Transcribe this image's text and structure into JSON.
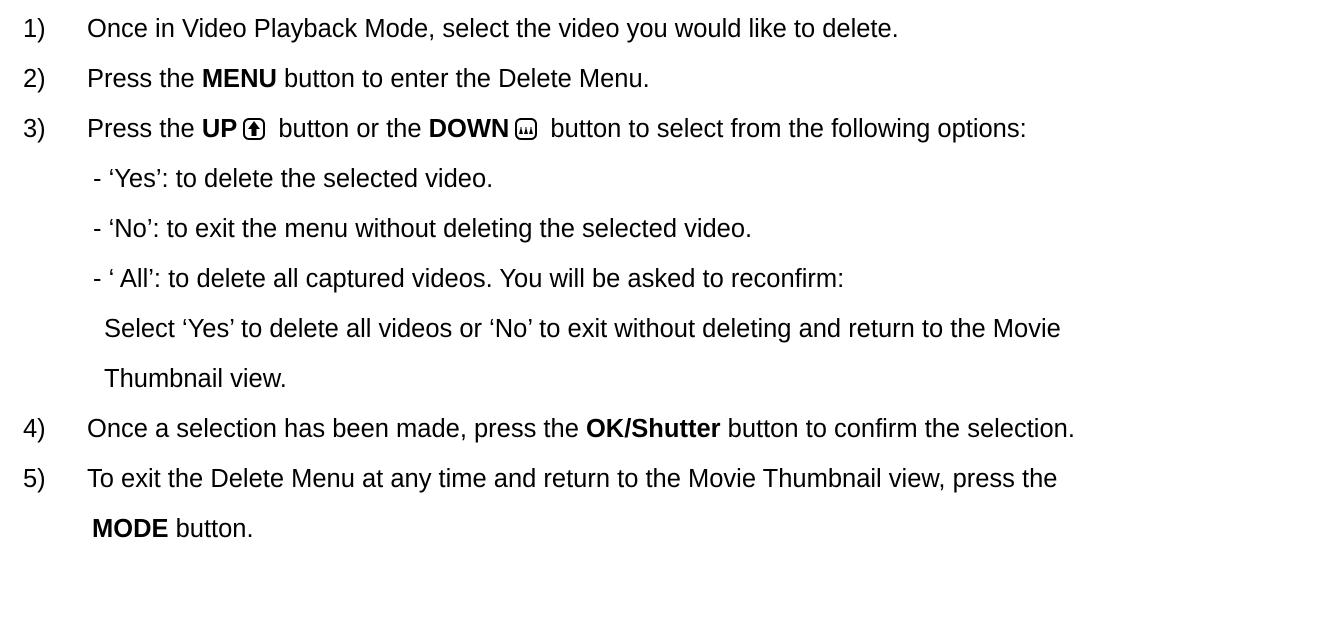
{
  "steps": [
    {
      "number": "1)",
      "text": "Once in Video Playback Mode, select the video you would like to delete."
    },
    {
      "number": "2)",
      "pre": "Press the ",
      "bold": "MENU",
      "post": " button to enter the Delete Menu."
    },
    {
      "number": "3)",
      "pre": "Press the ",
      "bold_up": "UP",
      "icon_up": "up-arrow-icon",
      "mid": " button or the ",
      "bold_down": "DOWN",
      "icon_down": "down-mountains-icon",
      "post": " button to select from the following options:",
      "options": [
        "- ‘Yes’: to delete the selected video.",
        "- ‘No’: to exit the menu without deleting the selected video.",
        "- ‘ All’: to delete all captured videos. You will be asked to reconfirm:"
      ],
      "continuation": [
        "Select ‘Yes’ to delete all videos or ‘No’ to exit without deleting and return to the Movie",
        "Thumbnail view."
      ]
    },
    {
      "number": "4)",
      "pre": "Once a selection has been made, press the ",
      "bold": "OK/Shutter",
      "post": " button to confirm the selection."
    },
    {
      "number": "5)",
      "text": "To exit the Delete Menu at any time and return to the Movie Thumbnail view, press the",
      "bold": "MODE",
      "post": " button."
    }
  ],
  "colors": {
    "text": "#000000",
    "background": "#ffffff"
  }
}
